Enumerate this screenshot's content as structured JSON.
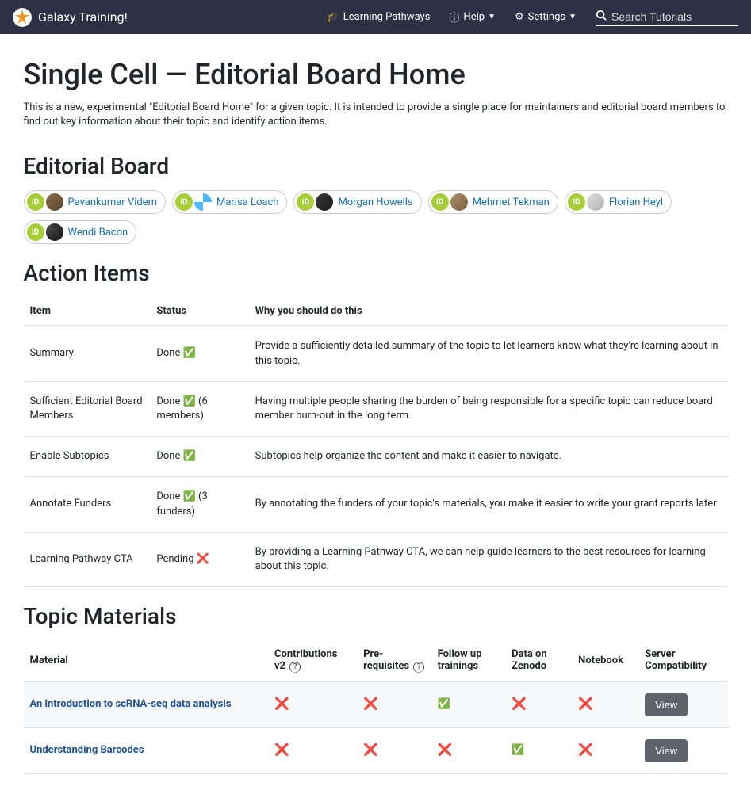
{
  "navbar": {
    "brand": "Galaxy Training!",
    "learning_pathways": "Learning Pathways",
    "help": "Help",
    "settings": "Settings",
    "search_placeholder": "Search Tutorials"
  },
  "page": {
    "title": "Single Cell — Editorial Board Home",
    "intro": "This is a new, experimental \"Editorial Board Home\" for a given topic. It is intended to provide a single place for maintainers and editorial board members to find out key information about their topic and identify action items."
  },
  "editorial_board": {
    "heading": "Editorial Board",
    "members": [
      {
        "name": "Pavankumar Videm",
        "avatar_class": "avatar-1"
      },
      {
        "name": "Marisa Loach",
        "avatar_class": "avatar-2"
      },
      {
        "name": "Morgan Howells",
        "avatar_class": "avatar-3"
      },
      {
        "name": "Mehmet Tekman",
        "avatar_class": "avatar-4"
      },
      {
        "name": "Florian Heyl",
        "avatar_class": "avatar-5"
      },
      {
        "name": "Wendi Bacon",
        "avatar_class": "avatar-6"
      }
    ]
  },
  "action_items": {
    "heading": "Action Items",
    "columns": {
      "item": "Item",
      "status": "Status",
      "why": "Why you should do this"
    },
    "rows": [
      {
        "item": "Summary",
        "status_text": "Done ",
        "status_icon": "check",
        "status_suffix": "",
        "why": "Provide a sufficiently detailed summary of the topic to let learners know what they're learning about in this topic."
      },
      {
        "item": "Sufficient Editorial Board Members",
        "status_text": "Done ",
        "status_icon": "check",
        "status_suffix": " (6 members)",
        "why": "Having multiple people sharing the burden of being responsible for a specific topic can reduce board member burn-out in the long term."
      },
      {
        "item": "Enable Subtopics",
        "status_text": "Done ",
        "status_icon": "check",
        "status_suffix": "",
        "why": "Subtopics help organize the content and make it easier to navigate."
      },
      {
        "item": "Annotate Funders",
        "status_text": "Done ",
        "status_icon": "check",
        "status_suffix": " (3 funders)",
        "why": "By annotating the funders of your topic's materials, you make it easier to write your grant reports later"
      },
      {
        "item": "Learning Pathway CTA",
        "status_text": "Pending ",
        "status_icon": "cross",
        "status_suffix": "",
        "why": "By providing a Learning Pathway CTA, we can help guide learners to the best resources for learning about this topic."
      }
    ]
  },
  "topic_materials": {
    "heading": "Topic Materials",
    "columns": {
      "material": "Material",
      "contributions": "Contributions v2 ",
      "prereq": "Pre-requisites ",
      "followup": "Follow up trainings",
      "zenodo": "Data on Zenodo",
      "notebook": "Notebook",
      "server": "Server Compatibility"
    },
    "view_label": "View",
    "rows": [
      {
        "material": "An introduction to scRNA-seq data analysis",
        "contributions": "cross",
        "prereq": "cross",
        "followup": "check",
        "zenodo": "cross",
        "notebook": "cross"
      },
      {
        "material": "Understanding Barcodes",
        "contributions": "cross",
        "prereq": "cross",
        "followup": "cross",
        "zenodo": "check",
        "notebook": "cross"
      }
    ]
  }
}
